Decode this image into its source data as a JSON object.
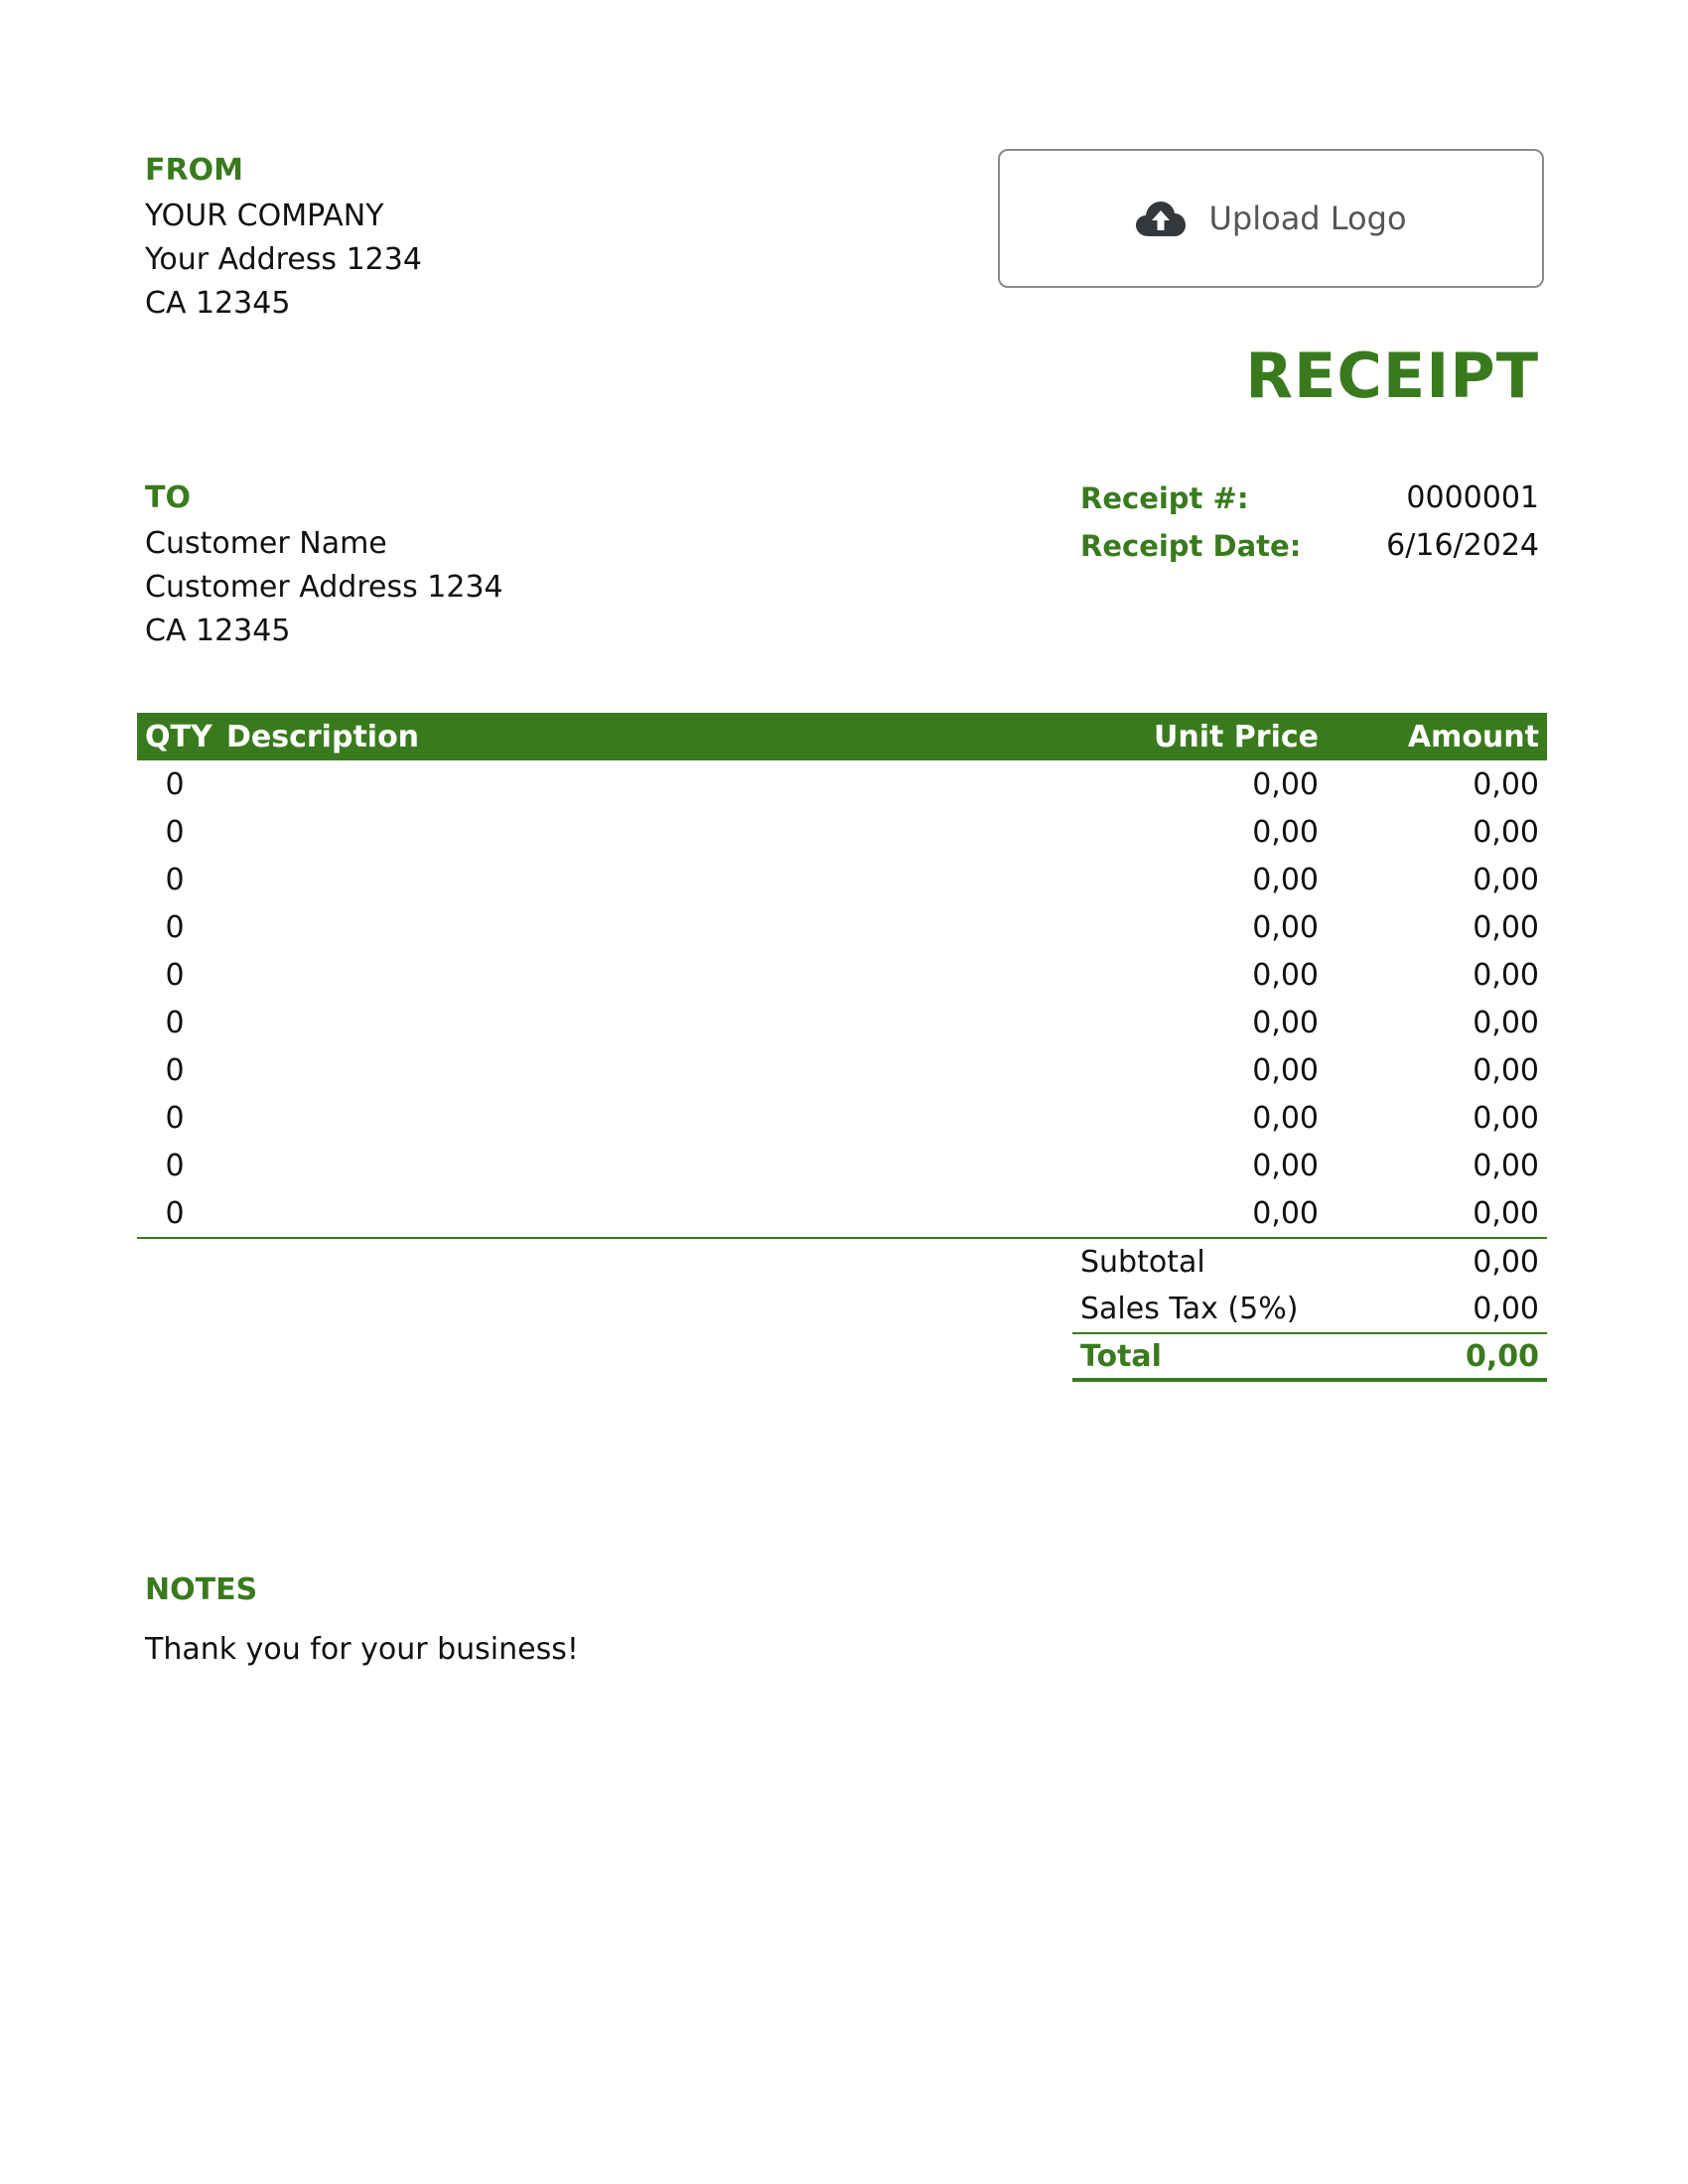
{
  "colors": {
    "accent": "#3a7a1f",
    "text": "#111111",
    "upload_border": "#8a8a8a"
  },
  "from": {
    "label": "FROM",
    "lines": [
      "YOUR COMPANY",
      "Your Address 1234",
      "CA 12345"
    ]
  },
  "upload_logo": {
    "icon": "cloud-upload-icon",
    "label": "Upload Logo"
  },
  "title": "RECEIPT",
  "to": {
    "label": "TO",
    "lines": [
      "Customer Name",
      "Customer Address 1234",
      "CA 12345"
    ]
  },
  "meta": {
    "receipt_number_label": "Receipt #:",
    "receipt_number": "0000001",
    "receipt_date_label": "Receipt Date:",
    "receipt_date": "6/16/2024"
  },
  "items": {
    "headers": {
      "qty": "QTY",
      "description": "Description",
      "unit_price": "Unit Price",
      "amount": "Amount"
    },
    "rows": [
      {
        "qty": "0",
        "description": "",
        "unit_price": "0,00",
        "amount": "0,00"
      },
      {
        "qty": "0",
        "description": "",
        "unit_price": "0,00",
        "amount": "0,00"
      },
      {
        "qty": "0",
        "description": "",
        "unit_price": "0,00",
        "amount": "0,00"
      },
      {
        "qty": "0",
        "description": "",
        "unit_price": "0,00",
        "amount": "0,00"
      },
      {
        "qty": "0",
        "description": "",
        "unit_price": "0,00",
        "amount": "0,00"
      },
      {
        "qty": "0",
        "description": "",
        "unit_price": "0,00",
        "amount": "0,00"
      },
      {
        "qty": "0",
        "description": "",
        "unit_price": "0,00",
        "amount": "0,00"
      },
      {
        "qty": "0",
        "description": "",
        "unit_price": "0,00",
        "amount": "0,00"
      },
      {
        "qty": "0",
        "description": "",
        "unit_price": "0,00",
        "amount": "0,00"
      },
      {
        "qty": "0",
        "description": "",
        "unit_price": "0,00",
        "amount": "0,00"
      }
    ]
  },
  "totals": {
    "subtotal_label": "Subtotal",
    "subtotal": "0,00",
    "tax_label": "Sales Tax (5%)",
    "tax": "0,00",
    "total_label": "Total",
    "total": "0,00"
  },
  "notes": {
    "label": "NOTES",
    "text": "Thank you for your business!"
  }
}
